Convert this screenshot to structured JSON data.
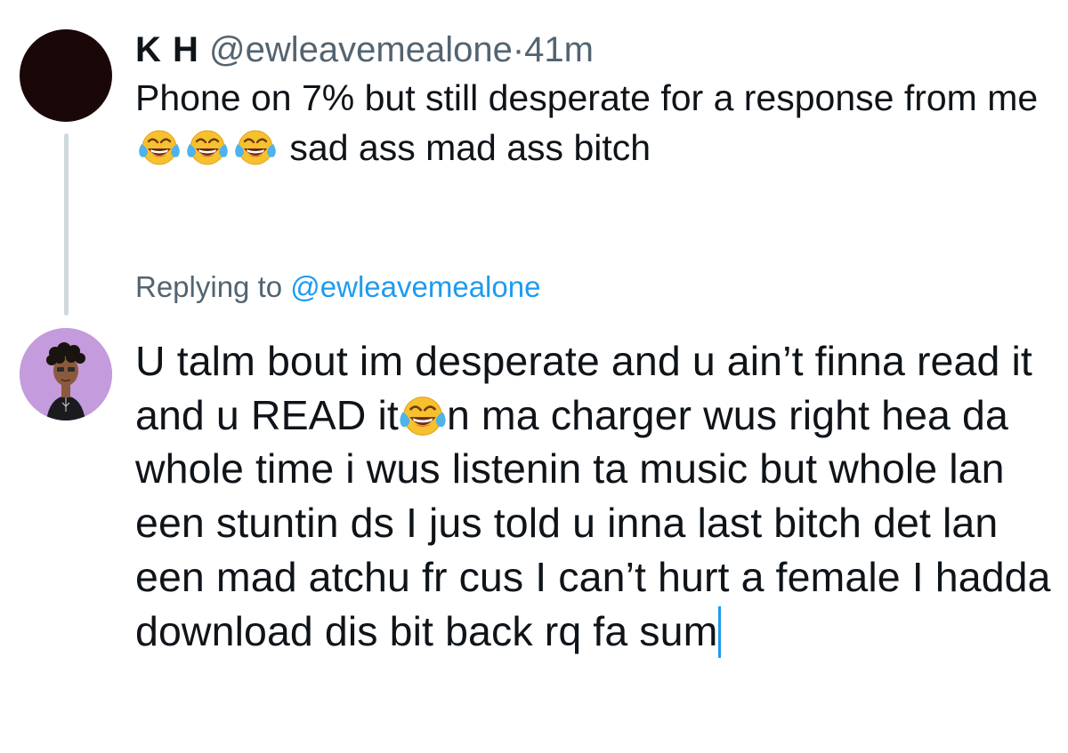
{
  "original_tweet": {
    "display_name": "K H",
    "handle": "@ewleavemealone",
    "separator": "·",
    "time": "41m",
    "text_part1": "Phone on 7% but still desperate for a response from me",
    "emoji": "face-with-tears-of-joy",
    "emoji_count": 3,
    "text_part2": "sad ass mad ass bitch"
  },
  "reply_context": {
    "label": "Replying to",
    "mention": "@ewleavemealone"
  },
  "reply_compose": {
    "text_before_emoji": "U talm bout im desperate and u ain’t finna read it and u READ it",
    "emoji": "face-with-tears-of-joy",
    "text_after_emoji": "n ma charger wus right hea da whole time i wus listenin ta music but whole lan een stuntin ds I jus told u inna last bitch det lan een mad atchu fr cus I can’t hurt a female I hadda download dis bit back rq fa sum"
  },
  "colors": {
    "text": "#0f1419",
    "secondary": "#536471",
    "accent": "#1d9bf0",
    "thread_line": "#cfd9de",
    "avatar_top": "#1a0707",
    "avatar_bottom": "#c49bdc"
  }
}
